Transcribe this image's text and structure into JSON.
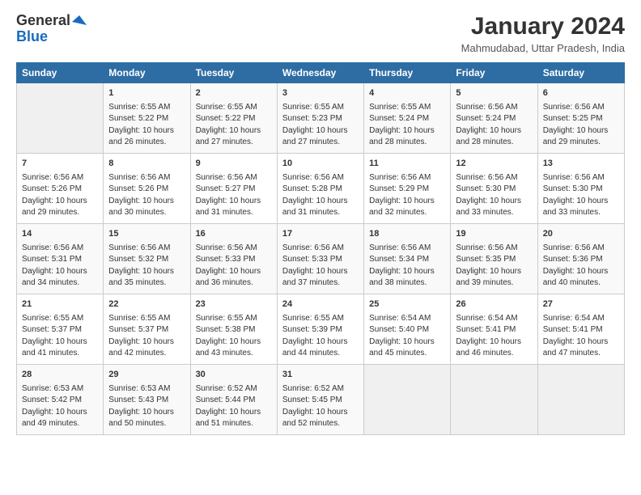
{
  "header": {
    "logo_line1": "General",
    "logo_line2": "Blue",
    "main_title": "January 2024",
    "subtitle": "Mahmudabad, Uttar Pradesh, India"
  },
  "calendar": {
    "days_of_week": [
      "Sunday",
      "Monday",
      "Tuesday",
      "Wednesday",
      "Thursday",
      "Friday",
      "Saturday"
    ],
    "weeks": [
      [
        {
          "day": "",
          "sunrise": "",
          "sunset": "",
          "daylight": "",
          "empty": true
        },
        {
          "day": "1",
          "sunrise": "Sunrise: 6:55 AM",
          "sunset": "Sunset: 5:22 PM",
          "daylight": "Daylight: 10 hours and 26 minutes."
        },
        {
          "day": "2",
          "sunrise": "Sunrise: 6:55 AM",
          "sunset": "Sunset: 5:22 PM",
          "daylight": "Daylight: 10 hours and 27 minutes."
        },
        {
          "day": "3",
          "sunrise": "Sunrise: 6:55 AM",
          "sunset": "Sunset: 5:23 PM",
          "daylight": "Daylight: 10 hours and 27 minutes."
        },
        {
          "day": "4",
          "sunrise": "Sunrise: 6:55 AM",
          "sunset": "Sunset: 5:24 PM",
          "daylight": "Daylight: 10 hours and 28 minutes."
        },
        {
          "day": "5",
          "sunrise": "Sunrise: 6:56 AM",
          "sunset": "Sunset: 5:24 PM",
          "daylight": "Daylight: 10 hours and 28 minutes."
        },
        {
          "day": "6",
          "sunrise": "Sunrise: 6:56 AM",
          "sunset": "Sunset: 5:25 PM",
          "daylight": "Daylight: 10 hours and 29 minutes."
        }
      ],
      [
        {
          "day": "7",
          "sunrise": "Sunrise: 6:56 AM",
          "sunset": "Sunset: 5:26 PM",
          "daylight": "Daylight: 10 hours and 29 minutes."
        },
        {
          "day": "8",
          "sunrise": "Sunrise: 6:56 AM",
          "sunset": "Sunset: 5:26 PM",
          "daylight": "Daylight: 10 hours and 30 minutes."
        },
        {
          "day": "9",
          "sunrise": "Sunrise: 6:56 AM",
          "sunset": "Sunset: 5:27 PM",
          "daylight": "Daylight: 10 hours and 31 minutes."
        },
        {
          "day": "10",
          "sunrise": "Sunrise: 6:56 AM",
          "sunset": "Sunset: 5:28 PM",
          "daylight": "Daylight: 10 hours and 31 minutes."
        },
        {
          "day": "11",
          "sunrise": "Sunrise: 6:56 AM",
          "sunset": "Sunset: 5:29 PM",
          "daylight": "Daylight: 10 hours and 32 minutes."
        },
        {
          "day": "12",
          "sunrise": "Sunrise: 6:56 AM",
          "sunset": "Sunset: 5:30 PM",
          "daylight": "Daylight: 10 hours and 33 minutes."
        },
        {
          "day": "13",
          "sunrise": "Sunrise: 6:56 AM",
          "sunset": "Sunset: 5:30 PM",
          "daylight": "Daylight: 10 hours and 33 minutes."
        }
      ],
      [
        {
          "day": "14",
          "sunrise": "Sunrise: 6:56 AM",
          "sunset": "Sunset: 5:31 PM",
          "daylight": "Daylight: 10 hours and 34 minutes."
        },
        {
          "day": "15",
          "sunrise": "Sunrise: 6:56 AM",
          "sunset": "Sunset: 5:32 PM",
          "daylight": "Daylight: 10 hours and 35 minutes."
        },
        {
          "day": "16",
          "sunrise": "Sunrise: 6:56 AM",
          "sunset": "Sunset: 5:33 PM",
          "daylight": "Daylight: 10 hours and 36 minutes."
        },
        {
          "day": "17",
          "sunrise": "Sunrise: 6:56 AM",
          "sunset": "Sunset: 5:33 PM",
          "daylight": "Daylight: 10 hours and 37 minutes."
        },
        {
          "day": "18",
          "sunrise": "Sunrise: 6:56 AM",
          "sunset": "Sunset: 5:34 PM",
          "daylight": "Daylight: 10 hours and 38 minutes."
        },
        {
          "day": "19",
          "sunrise": "Sunrise: 6:56 AM",
          "sunset": "Sunset: 5:35 PM",
          "daylight": "Daylight: 10 hours and 39 minutes."
        },
        {
          "day": "20",
          "sunrise": "Sunrise: 6:56 AM",
          "sunset": "Sunset: 5:36 PM",
          "daylight": "Daylight: 10 hours and 40 minutes."
        }
      ],
      [
        {
          "day": "21",
          "sunrise": "Sunrise: 6:55 AM",
          "sunset": "Sunset: 5:37 PM",
          "daylight": "Daylight: 10 hours and 41 minutes."
        },
        {
          "day": "22",
          "sunrise": "Sunrise: 6:55 AM",
          "sunset": "Sunset: 5:37 PM",
          "daylight": "Daylight: 10 hours and 42 minutes."
        },
        {
          "day": "23",
          "sunrise": "Sunrise: 6:55 AM",
          "sunset": "Sunset: 5:38 PM",
          "daylight": "Daylight: 10 hours and 43 minutes."
        },
        {
          "day": "24",
          "sunrise": "Sunrise: 6:55 AM",
          "sunset": "Sunset: 5:39 PM",
          "daylight": "Daylight: 10 hours and 44 minutes."
        },
        {
          "day": "25",
          "sunrise": "Sunrise: 6:54 AM",
          "sunset": "Sunset: 5:40 PM",
          "daylight": "Daylight: 10 hours and 45 minutes."
        },
        {
          "day": "26",
          "sunrise": "Sunrise: 6:54 AM",
          "sunset": "Sunset: 5:41 PM",
          "daylight": "Daylight: 10 hours and 46 minutes."
        },
        {
          "day": "27",
          "sunrise": "Sunrise: 6:54 AM",
          "sunset": "Sunset: 5:41 PM",
          "daylight": "Daylight: 10 hours and 47 minutes."
        }
      ],
      [
        {
          "day": "28",
          "sunrise": "Sunrise: 6:53 AM",
          "sunset": "Sunset: 5:42 PM",
          "daylight": "Daylight: 10 hours and 49 minutes."
        },
        {
          "day": "29",
          "sunrise": "Sunrise: 6:53 AM",
          "sunset": "Sunset: 5:43 PM",
          "daylight": "Daylight: 10 hours and 50 minutes."
        },
        {
          "day": "30",
          "sunrise": "Sunrise: 6:52 AM",
          "sunset": "Sunset: 5:44 PM",
          "daylight": "Daylight: 10 hours and 51 minutes."
        },
        {
          "day": "31",
          "sunrise": "Sunrise: 6:52 AM",
          "sunset": "Sunset: 5:45 PM",
          "daylight": "Daylight: 10 hours and 52 minutes."
        },
        {
          "day": "",
          "sunrise": "",
          "sunset": "",
          "daylight": "",
          "empty": true
        },
        {
          "day": "",
          "sunrise": "",
          "sunset": "",
          "daylight": "",
          "empty": true
        },
        {
          "day": "",
          "sunrise": "",
          "sunset": "",
          "daylight": "",
          "empty": true
        }
      ]
    ]
  }
}
